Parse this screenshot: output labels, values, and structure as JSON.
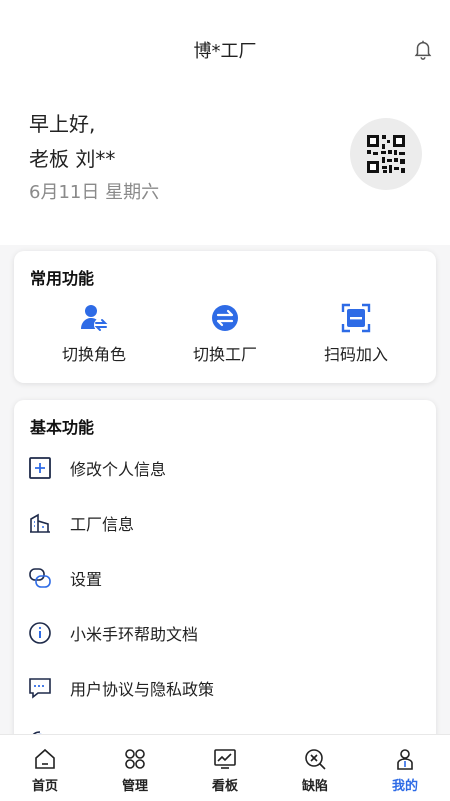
{
  "header": {
    "title": "博*工厂",
    "bell_icon": "bell-icon"
  },
  "greeting": {
    "line1": "早上好,",
    "line2": "老板 刘**",
    "date": "6月11日 星期六",
    "qr_icon": "qr-code-icon"
  },
  "common_functions": {
    "title": "常用功能",
    "items": [
      {
        "label": "切换角色",
        "icon": "switch-role-icon"
      },
      {
        "label": "切换工厂",
        "icon": "switch-factory-icon"
      },
      {
        "label": "扫码加入",
        "icon": "scan-icon"
      }
    ]
  },
  "basic_functions": {
    "title": "基本功能",
    "items": [
      {
        "label": "修改个人信息",
        "icon": "edit-profile-icon"
      },
      {
        "label": "工厂信息",
        "icon": "factory-icon"
      },
      {
        "label": "设置",
        "icon": "settings-icon"
      },
      {
        "label": "小米手环帮助文档",
        "icon": "info-icon"
      },
      {
        "label": "用户协议与隐私政策",
        "icon": "chat-icon"
      }
    ]
  },
  "tabbar": {
    "tabs": [
      {
        "label": "首页",
        "icon": "home-icon"
      },
      {
        "label": "管理",
        "icon": "manage-icon"
      },
      {
        "label": "看板",
        "icon": "dashboard-icon"
      },
      {
        "label": "缺陷",
        "icon": "defect-icon"
      },
      {
        "label": "我的",
        "icon": "profile-icon",
        "active": true
      }
    ]
  },
  "colors": {
    "accent": "#2e6be6",
    "background": "#f6f6f7"
  }
}
